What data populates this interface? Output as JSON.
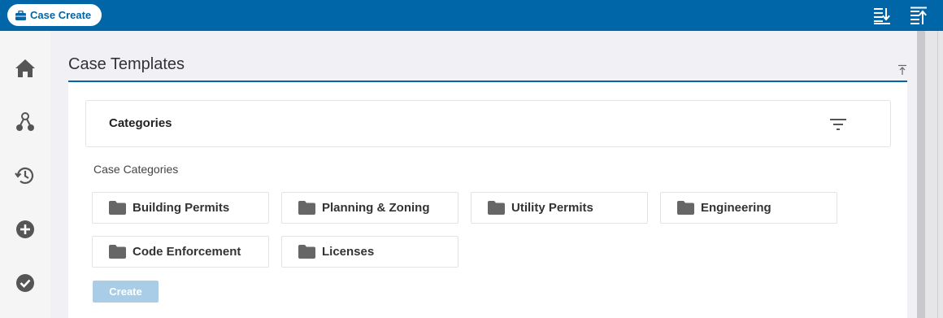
{
  "topbar": {
    "case_create_label": "Case Create",
    "icons": [
      "sort-descending-icon",
      "sort-ascending-icon"
    ],
    "color": "#0066a8"
  },
  "leftnav": {
    "items": [
      "home-icon",
      "workflow-icon",
      "history-icon",
      "add-circle-icon",
      "check-circle-icon"
    ]
  },
  "main": {
    "title": "Case Templates",
    "categories_header": "Categories",
    "case_categories_label": "Case Categories",
    "tiles": [
      {
        "label": "Building Permits"
      },
      {
        "label": "Planning & Zoning"
      },
      {
        "label": "Utility Permits"
      },
      {
        "label": "Engineering"
      },
      {
        "label": "Code Enforcement"
      },
      {
        "label": "Licenses"
      }
    ],
    "create_label": "Create"
  }
}
